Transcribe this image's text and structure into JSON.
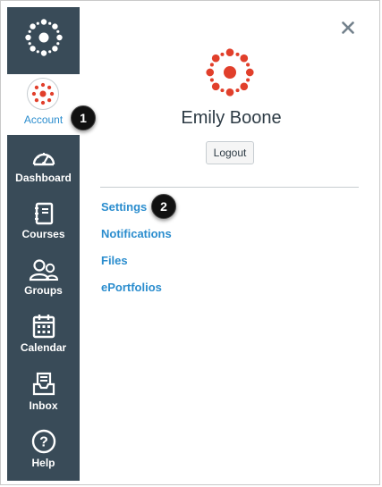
{
  "sidebar": {
    "logo_icon": "canvas-logo-icon",
    "account": {
      "label": "Account",
      "icon": "user-avatar-icon"
    },
    "items": [
      {
        "label": "Dashboard",
        "icon": "dashboard-icon"
      },
      {
        "label": "Courses",
        "icon": "courses-icon"
      },
      {
        "label": "Groups",
        "icon": "groups-icon"
      },
      {
        "label": "Calendar",
        "icon": "calendar-icon"
      },
      {
        "label": "Inbox",
        "icon": "inbox-icon"
      },
      {
        "label": "Help",
        "icon": "help-icon"
      }
    ]
  },
  "tray": {
    "close_icon": "close-icon",
    "user_name": "Emily Boone",
    "logout_label": "Logout",
    "links": [
      "Settings",
      "Notifications",
      "Files",
      "ePortfolios"
    ]
  },
  "callouts": [
    "1",
    "2"
  ],
  "colors": {
    "sidebar_bg": "#394b58",
    "link": "#2b8dce",
    "brand_red": "#e13f2b",
    "text": "#2d3b45"
  }
}
